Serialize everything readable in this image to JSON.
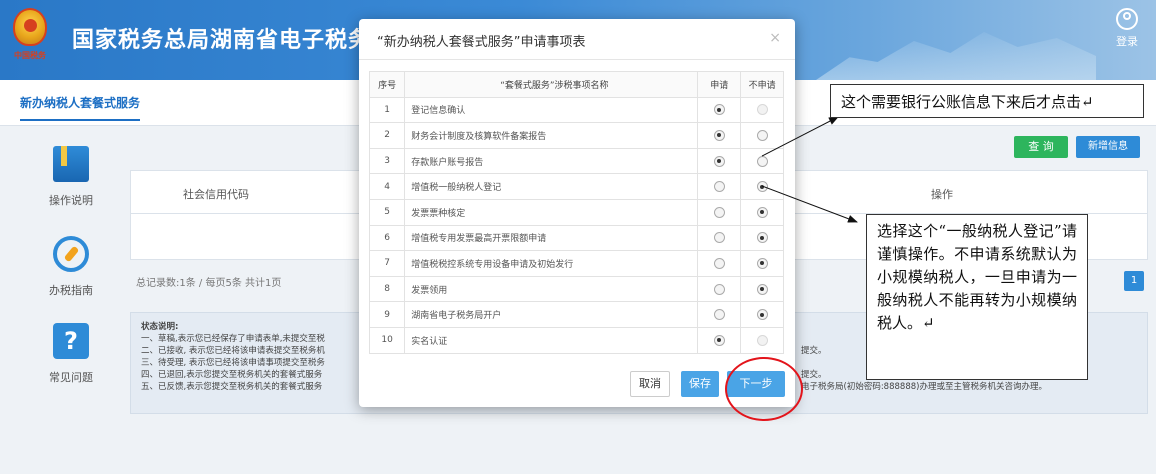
{
  "header": {
    "site_title": "国家税务总局湖南省电子税务局",
    "emblem_text": "中国税务",
    "login_label": "登录"
  },
  "tabs": {
    "active": "新办纳税人套餐式服务"
  },
  "sidebar": {
    "items": [
      {
        "label": "操作说明",
        "icon": "book-icon"
      },
      {
        "label": "办税指南",
        "icon": "compass-icon"
      },
      {
        "label": "常见问题",
        "icon": "question-icon"
      }
    ]
  },
  "toolbar": {
    "query_label": "查 询",
    "new_label": "新增信息"
  },
  "grid": {
    "col_credit_code": "社会信用代码",
    "col_action": "操作",
    "pager_text": "总记录数:1条 / 每页5条 共计1页",
    "page_number": "1"
  },
  "status_notes": {
    "title": "状态说明:",
    "lines": [
      {
        "left": "一、草稿,表示您已经保存了申请表单,未提交至税",
        "right": ""
      },
      {
        "left": "二、已接收, 表示您已经将该申请表提交至税务机",
        "right": "提交。"
      },
      {
        "left": "三、待受理, 表示您已经将该申请事项提交至税务",
        "right": ""
      },
      {
        "left": "四、已退回,表示您提交至税务机关的套餐式服务",
        "right": "提交。"
      },
      {
        "left": "五、已反馈,表示您提交至税务机关的套餐式服务",
        "right": "电子税务局(初始密码:888888)办理或至主管税务机关咨询办理。"
      }
    ]
  },
  "modal": {
    "title": "“新办纳税人套餐式服务”申请事项表",
    "close": "×",
    "headers": {
      "no": "序号",
      "name": "“套餐式服务”涉税事项名称",
      "apply": "申请",
      "not_apply": "不申请"
    },
    "rows": [
      {
        "no": "1",
        "name": "登记信息确认",
        "apply": "selected",
        "not_apply": "disabled"
      },
      {
        "no": "2",
        "name": "财务会计制度及核算软件备案报告",
        "apply": "selected",
        "not_apply": "unselected"
      },
      {
        "no": "3",
        "name": "存款账户账号报告",
        "apply": "selected",
        "not_apply": "unselected"
      },
      {
        "no": "4",
        "name": "增值税一般纳税人登记",
        "apply": "unselected",
        "not_apply": "selected"
      },
      {
        "no": "5",
        "name": "发票票种核定",
        "apply": "unselected",
        "not_apply": "selected"
      },
      {
        "no": "6",
        "name": "增值税专用发票最高开票限额申请",
        "apply": "unselected",
        "not_apply": "selected"
      },
      {
        "no": "7",
        "name": "增值税税控系统专用设备申请及初始发行",
        "apply": "unselected",
        "not_apply": "selected"
      },
      {
        "no": "8",
        "name": "发票领用",
        "apply": "unselected",
        "not_apply": "selected"
      },
      {
        "no": "9",
        "name": "湖南省电子税务局开户",
        "apply": "unselected",
        "not_apply": "selected"
      },
      {
        "no": "10",
        "name": "实名认证",
        "apply": "selected",
        "not_apply": "disabled"
      }
    ],
    "buttons": {
      "cancel": "取消",
      "save": "保存",
      "next": "下一步"
    }
  },
  "annotations": {
    "note_1": "这个需要银行公账信息下来后才点击↵",
    "note_2": "选择这个“一般纳税人登记”请谨慎操作。不申请系统默认为小规模纳税人，一旦申请为一般纳税人不能再转为小规模纳税人。↵"
  },
  "colors": {
    "accent": "#2e8bd7",
    "annotation_ring": "#e3141b",
    "query_button": "#2db55d"
  }
}
